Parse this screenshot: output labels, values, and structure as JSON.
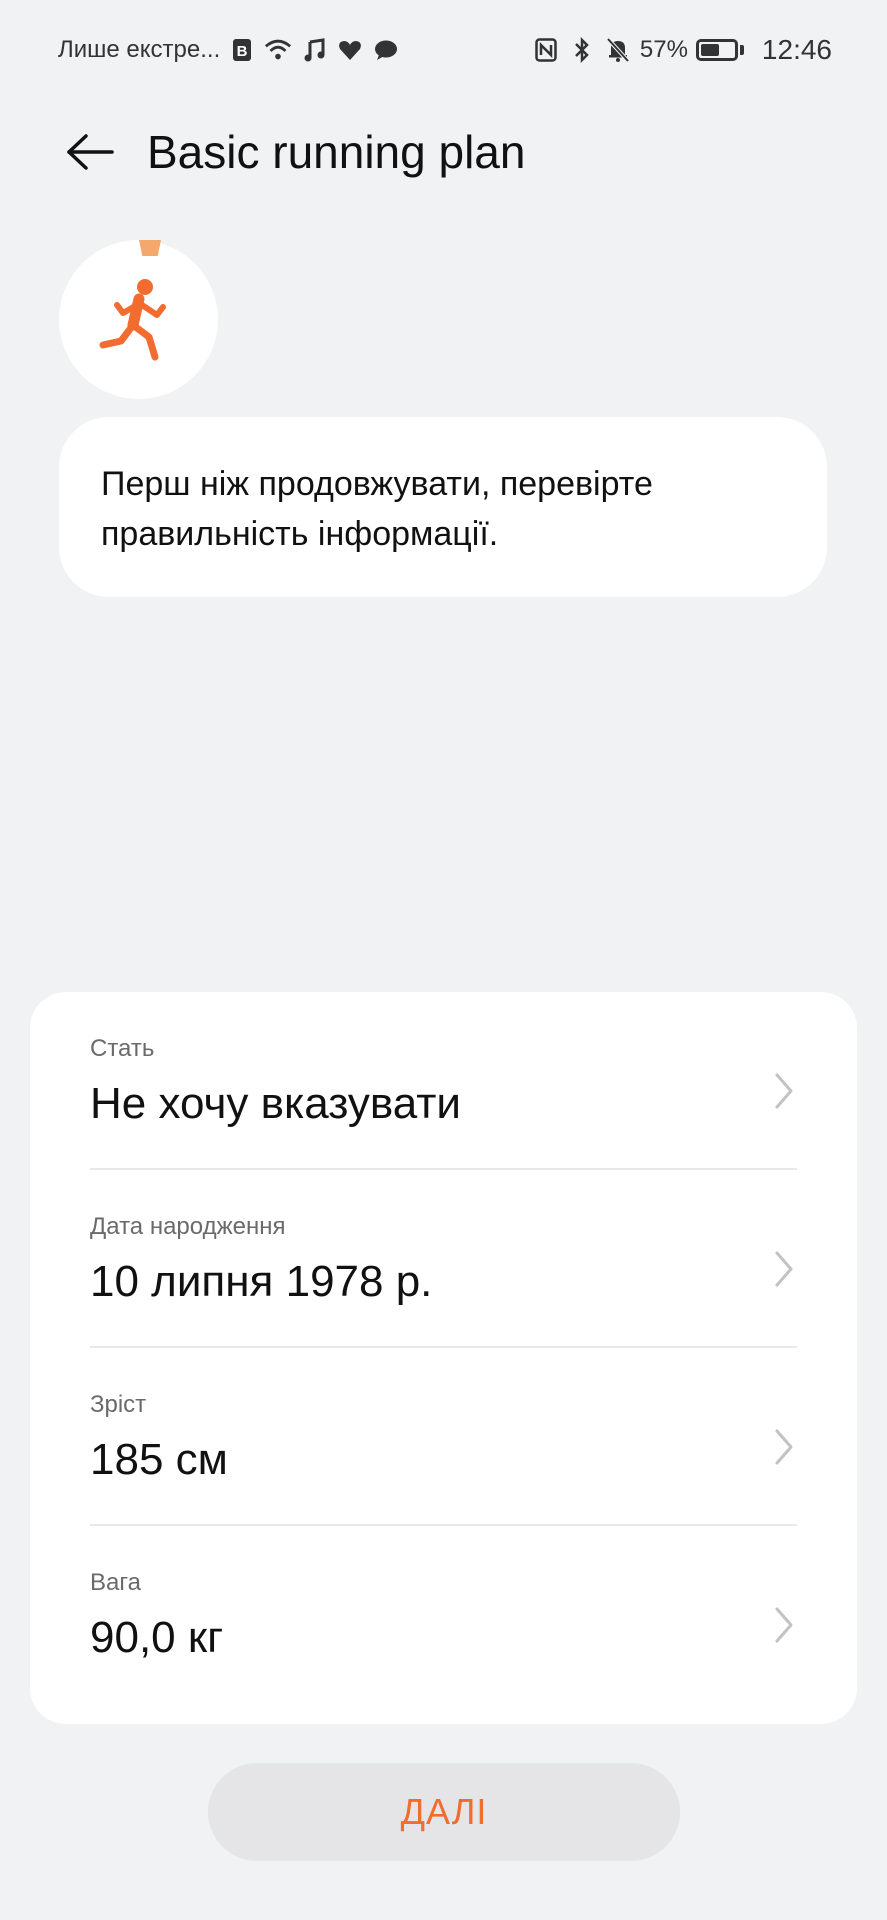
{
  "status_bar": {
    "carrier_text": "Лише екстре...",
    "battery_percent": "57%",
    "battery_level": 0.57,
    "time": "12:46",
    "icons_left": [
      "b-icon",
      "wifi-icon",
      "music-icon",
      "heart-icon",
      "chat-icon"
    ],
    "icons_right": [
      "nfc-icon",
      "bluetooth-icon",
      "silent-bell-icon",
      "battery-icon"
    ]
  },
  "header": {
    "title": "Basic running plan"
  },
  "avatar": {
    "icon": "running-person-icon",
    "accent_color": "#f26c2f"
  },
  "info_card": {
    "text": "Перш ніж продовжувати, перевірте правильність інформації."
  },
  "profile": {
    "rows": [
      {
        "label": "Стать",
        "value": "Не хочу вказувати"
      },
      {
        "label": "Дата народження",
        "value": "10 липня 1978 р."
      },
      {
        "label": "Зріст",
        "value": "185 см"
      },
      {
        "label": "Вага",
        "value": "90,0 кг"
      }
    ]
  },
  "next_button": {
    "label": "ДАЛІ"
  }
}
